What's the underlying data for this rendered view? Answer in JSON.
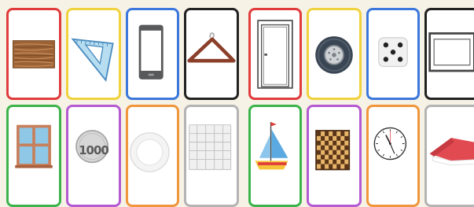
{
  "cards": [
    {
      "picture": "wood-plank",
      "border": "#e03c3c"
    },
    {
      "picture": "set-square-ruler",
      "border": "#f0d23c"
    },
    {
      "picture": "smartphone",
      "border": "#3c78dc"
    },
    {
      "picture": "clothes-hanger",
      "border": "#222222"
    },
    {
      "picture": "door",
      "border": "#e03c3c"
    },
    {
      "picture": "tire",
      "border": "#f0d23c"
    },
    {
      "picture": "dice",
      "border": "#3c78dc"
    },
    {
      "picture": "picture-frame",
      "border": "#222222"
    },
    {
      "picture": "window",
      "border": "#3cb44b"
    },
    {
      "picture": "coin",
      "border": "#b45ad2",
      "text": "1000"
    },
    {
      "picture": "plate",
      "border": "#f0963c"
    },
    {
      "picture": "tiles",
      "border": "#b4b4b4"
    },
    {
      "picture": "sailboat",
      "border": "#3cb44b"
    },
    {
      "picture": "checkerboard",
      "border": "#b45ad2"
    },
    {
      "picture": "wall-clock",
      "border": "#f0963c"
    },
    {
      "picture": "roof",
      "border": "#b4b4b4"
    }
  ]
}
